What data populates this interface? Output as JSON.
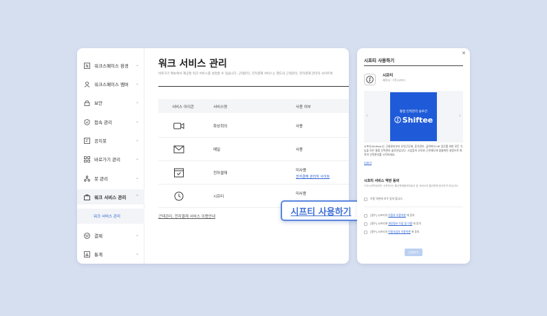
{
  "sidebar": {
    "items": [
      {
        "label": "워크스페이스 환경",
        "icon": "workspace-icon"
      },
      {
        "label": "워크스페이스 멤버",
        "icon": "user-icon"
      },
      {
        "label": "보안",
        "icon": "lock-icon"
      },
      {
        "label": "접속 관리",
        "icon": "shield-icon"
      },
      {
        "label": "공지봇",
        "icon": "notice-icon"
      },
      {
        "label": "바로가기 관리",
        "icon": "grid-icon"
      },
      {
        "label": "봇 관리",
        "icon": "bot-icon"
      },
      {
        "label": "워크 서비스 관리",
        "icon": "briefcase-icon"
      },
      {
        "label": "결제",
        "icon": "won-icon"
      },
      {
        "label": "통계",
        "icon": "chart-icon"
      }
    ],
    "sub_item": "워크 서비스 관리"
  },
  "main": {
    "title": "워크 서비스 관리",
    "description": "바로가기 메뉴에서 제공할 워크 서비스를 설정할 수 있습니다. 근태관리, 전자결재 서비스는 별도의 근태관리, 전자결재 관리자 사이트에",
    "columns": [
      "서비스 아이콘",
      "서비스명",
      "사용 여부"
    ],
    "rows": [
      {
        "icon": "video-icon",
        "name": "화상회의",
        "status": "사용",
        "link": ""
      },
      {
        "icon": "mail-icon",
        "name": "메일",
        "status": "사용",
        "link": ""
      },
      {
        "icon": "approval-icon",
        "name": "전자결재",
        "status": "미사용",
        "link": "전자결재 관리자 사이트"
      },
      {
        "icon": "clock-icon",
        "name": "시프티",
        "status": "미사용",
        "link": ""
      }
    ],
    "footnote": "근태관리, 전자결재 서비스 이용안내"
  },
  "callout": {
    "label": "시프티 사용하기"
  },
  "panel": {
    "title": "시프티 사용하기",
    "service_name": "시프티",
    "service_meta": "제작사 : (주)시프티",
    "banner_subtitle": "통합 인력관리 솔루션",
    "banner_brand": "Shiftee",
    "description": "시프티(Shiftee)는 근태관리부터 유연근무제, 휴가관리, 급여까지 HR 업무를 위한 모든 기능을 모은 통합 인력관리 솔루션입니다. 시업장의 규모와 근로제도에 맞춤화된 설정으로 최적의 인력관리를 시작하세요.",
    "more": "더보기",
    "terms_title": "시프티 서비스 약관 동의",
    "terms_note": "*(주)시프티(이하 '시프티')는 통신판매중개자로서 본 서비스의 통신판매 당사자가 아닙니다.",
    "agree_all": "이용 약관에 모두 동의 합니다.",
    "agree_items": [
      {
        "prefix": "[필수] 시프티의 ",
        "link": "이용자 이용약관",
        "suffix": "에 동의"
      },
      {
        "prefix": "[필수] 시프티에 ",
        "link": "개인정보 수집 및 이용",
        "suffix": "에 동의"
      },
      {
        "prefix": "[필수] 시프티의 ",
        "link": "이용사업자 이용약관",
        "suffix": "에 동의"
      }
    ],
    "button": "신청하기",
    "close": "×"
  },
  "colors": {
    "accent": "#2d62d2",
    "banner": "#1f5bd8",
    "background": "#d6dff0"
  }
}
